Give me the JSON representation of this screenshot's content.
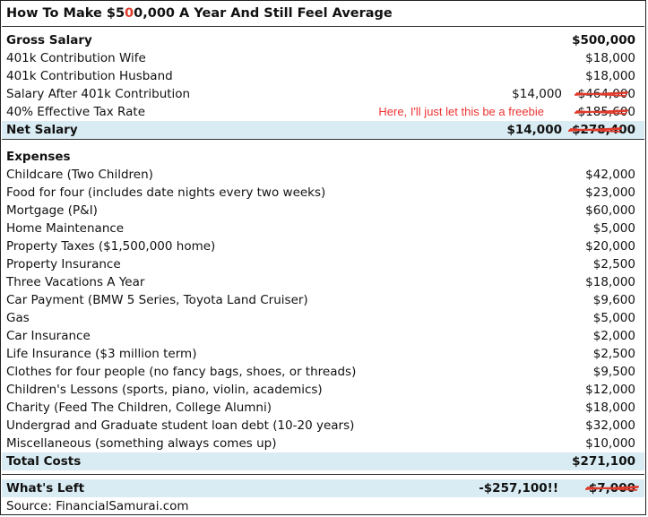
{
  "title": {
    "prefix": "How To Make $5",
    "edited_digit": "0",
    "suffix": "0,000 A Year And Still Feel Average"
  },
  "income": [
    {
      "label": "Gross Salary",
      "value": "$500,000",
      "bold": true
    },
    {
      "label": "401k Contribution Wife",
      "value": "$18,000"
    },
    {
      "label": "401k Contribution Husband",
      "value": "$18,000"
    },
    {
      "label": "Salary After 401k Contribution",
      "value": "$464,000",
      "new_value": "$14,000",
      "struck": true
    },
    {
      "label": "40% Effective Tax Rate",
      "value": "$185,600",
      "note": "Here, I'll just let this be a freebie",
      "struck": true
    },
    {
      "label": "Net Salary",
      "value": "$278,400",
      "new_value": "$14,000",
      "struck": true,
      "bold": true
    }
  ],
  "expenses_header": "Expenses",
  "expenses": [
    {
      "label": "Childcare (Two Children)",
      "value": "$42,000"
    },
    {
      "label": "Food for four (includes date nights every two weeks)",
      "value": "$23,000"
    },
    {
      "label": "Mortgage (P&I)",
      "value": "$60,000"
    },
    {
      "label": "Home Maintenance",
      "value": "$5,000"
    },
    {
      "label": "Property Taxes ($1,500,000 home)",
      "value": "$20,000"
    },
    {
      "label": "Property Insurance",
      "value": "$2,500"
    },
    {
      "label": "Three Vacations A Year",
      "value": "$18,000"
    },
    {
      "label": "Car Payment (BMW 5 Series, Toyota Land Cruiser)",
      "value": "$9,600"
    },
    {
      "label": "Gas",
      "value": "$5,000"
    },
    {
      "label": "Car Insurance",
      "value": "$2,000"
    },
    {
      "label": "Life Insurance ($3 million term)",
      "value": "$2,500"
    },
    {
      "label": "Clothes for four people (no fancy bags, shoes, or threads)",
      "value": "$9,500"
    },
    {
      "label": "Children's Lessons (sports, piano, violin, academics)",
      "value": "$12,000"
    },
    {
      "label": "Charity (Feed The Children, College Alumni)",
      "value": "$18,000"
    },
    {
      "label": "Undergrad and Graduate student loan debt (10-20 years)",
      "value": "$32,000"
    },
    {
      "label": "Miscellaneous (something always comes up)",
      "value": "$10,000"
    }
  ],
  "total_costs": {
    "label": "Total Costs",
    "value": "$271,100"
  },
  "whats_left": {
    "label": "What's Left",
    "value": "$7,000",
    "new_value": "-$257,100!!"
  },
  "source": "Source: FinancialSamurai.com",
  "colors": {
    "highlight": "#d9ecf3",
    "annotation_red": "#e03a2a"
  }
}
